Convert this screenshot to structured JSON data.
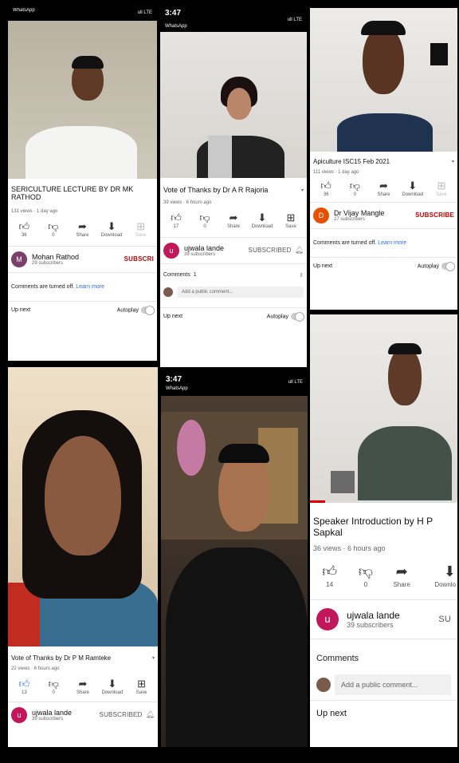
{
  "panel1": {
    "statusbar": {
      "app": "WhatsApp",
      "icons": "ull LTE"
    },
    "video_title": "SERICULTURE LECTURE BY DR  MK RATHOD",
    "meta": "131 views · 1 day ago",
    "likes": "36",
    "dislikes": "0",
    "share": "Share",
    "download": "Download",
    "save": "Save",
    "channel": {
      "name": "Mohan Rathod",
      "subs": "29 subscribers",
      "action": "SUBSCRI"
    },
    "comments_text": "Comments are turned off.",
    "learn_more": "Learn more",
    "upnext": "Up next",
    "autoplay": "Autoplay"
  },
  "panel2": {
    "statusbar": {
      "time": "3:47",
      "app": "WhatsApp",
      "icons": "ull LTE"
    },
    "video_title": "Vote of Thanks by Dr A R Rajoria",
    "meta": "39 views · 6 hours ago",
    "likes": "17",
    "dislikes": "0",
    "share": "Share",
    "download": "Download",
    "save": "Save",
    "channel": {
      "initial": "u",
      "name": "ujwala lande",
      "subs": "39 subscribers",
      "action": "SUBSCRIBED"
    },
    "comments_label": "Comments",
    "comments_count": "1",
    "comment_placeholder": "Add a public comment...",
    "upnext": "Up next",
    "autoplay": "Autoplay"
  },
  "panel3": {
    "video_title": "Apiculture ISC15 Feb 2021",
    "meta": "111 views · 1 day ago",
    "likes": "36",
    "dislikes": "0",
    "share": "Share",
    "download": "Download",
    "save": "Save",
    "channel": {
      "initial": "D",
      "name": "Dr Vijay Mangle",
      "subs": "27 subscribers",
      "action": "SUBSCRIBE"
    },
    "comments_text": "Comments are turned off.",
    "learn_more": "Learn more",
    "upnext": "Up next",
    "autoplay": "Autoplay"
  },
  "panel4": {
    "video_title": "Vote of Thanks by Dr P M Ramteke",
    "meta": "22 views · 6 hours ago",
    "likes": "13",
    "dislikes": "0",
    "share": "Share",
    "download": "Download",
    "save": "Save",
    "channel": {
      "initial": "u",
      "name": "ujwala lande",
      "subs": "39 subscribers",
      "action": "SUBSCRIBED"
    }
  },
  "panel5": {
    "statusbar": {
      "time": "3:47",
      "app": "WhatsApp",
      "icons": "ull LTE"
    }
  },
  "panel6": {
    "video_title": "Speaker Introduction by H P Sapkal",
    "meta": "36 views · 6 hours ago",
    "likes": "14",
    "dislikes": "0",
    "share": "Share",
    "download": "Downlo",
    "channel": {
      "initial": "u",
      "name": "ujwala lande",
      "subs": "39 subscribers",
      "action": "SU"
    },
    "comments_label": "Comments",
    "comment_placeholder": "Add a public comment...",
    "upnext": "Up next"
  },
  "colors": {
    "accent_blue": "#2a6fdb",
    "subscribe_red": "#cc0000",
    "avatar_red": "#c2185b",
    "avatar_orange": "#e65100"
  },
  "icons": {
    "like": "thumbs-up-icon",
    "dislike": "thumbs-down-icon",
    "share": "share-icon",
    "download": "download-icon",
    "save": "save-icon",
    "bell": "bell-icon"
  }
}
